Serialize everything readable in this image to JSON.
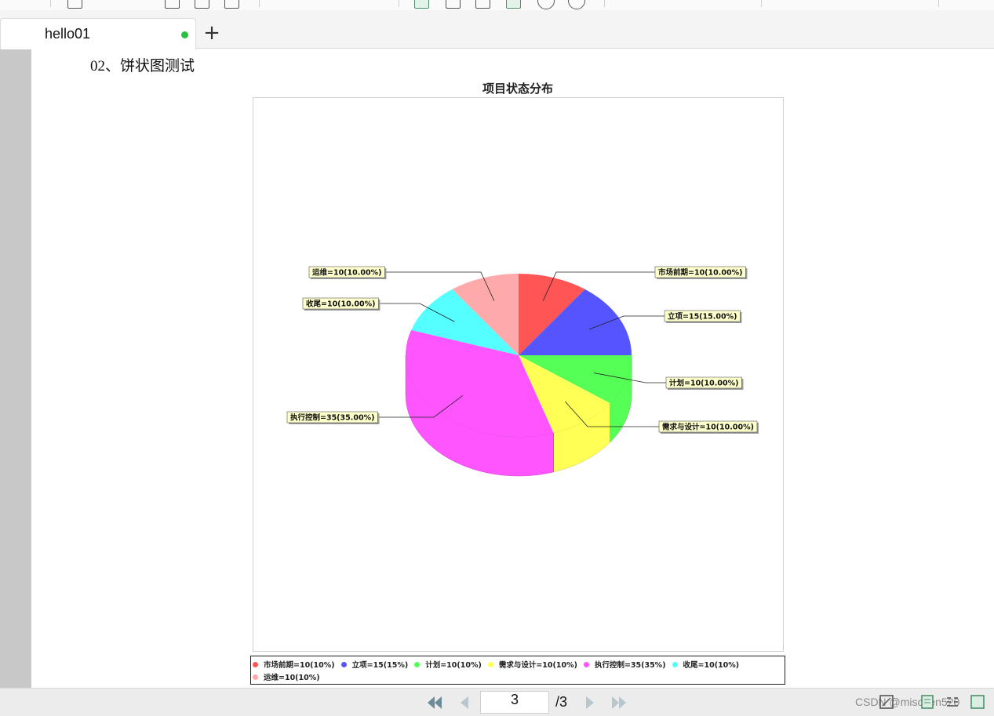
{
  "tab": {
    "title": "hello01",
    "status_color": "#27c13c"
  },
  "document": {
    "section_heading": "02、饼状图测试"
  },
  "chart_data": {
    "type": "pie",
    "title": "项目状态分布",
    "style": "3d",
    "slices": [
      {
        "name": "市场前期",
        "value": 10,
        "label": "市场前期=10(10.00%)",
        "legend": "市场前期=10(10%)",
        "color": "#ff5555"
      },
      {
        "name": "立项",
        "value": 15,
        "label": "立项=15(15.00%)",
        "legend": "立项=15(15%)",
        "color": "#5555ff"
      },
      {
        "name": "计划",
        "value": 10,
        "label": "计划=10(10.00%)",
        "legend": "计划=10(10%)",
        "color": "#55ff55"
      },
      {
        "name": "需求与设计",
        "value": 10,
        "label": "需求与设计=10(10.00%)",
        "legend": "需求与设计=10(10%)",
        "color": "#ffff55"
      },
      {
        "name": "执行控制",
        "value": 35,
        "label": "执行控制=35(35.00%)",
        "legend": "执行控制=35(35%)",
        "color": "#ff55ff"
      },
      {
        "name": "收尾",
        "value": 10,
        "label": "收尾=10(10.00%)",
        "legend": "收尾=10(10%)",
        "color": "#55ffff"
      },
      {
        "name": "运维",
        "value": 10,
        "label": "运维=10(10.00%)",
        "legend": "运维=10(10%)",
        "color": "#ffaaaa"
      }
    ],
    "legend_position": "bottom"
  },
  "pager": {
    "current_page": "3",
    "total": "/3"
  },
  "watermark": "CSDN @mischen520"
}
